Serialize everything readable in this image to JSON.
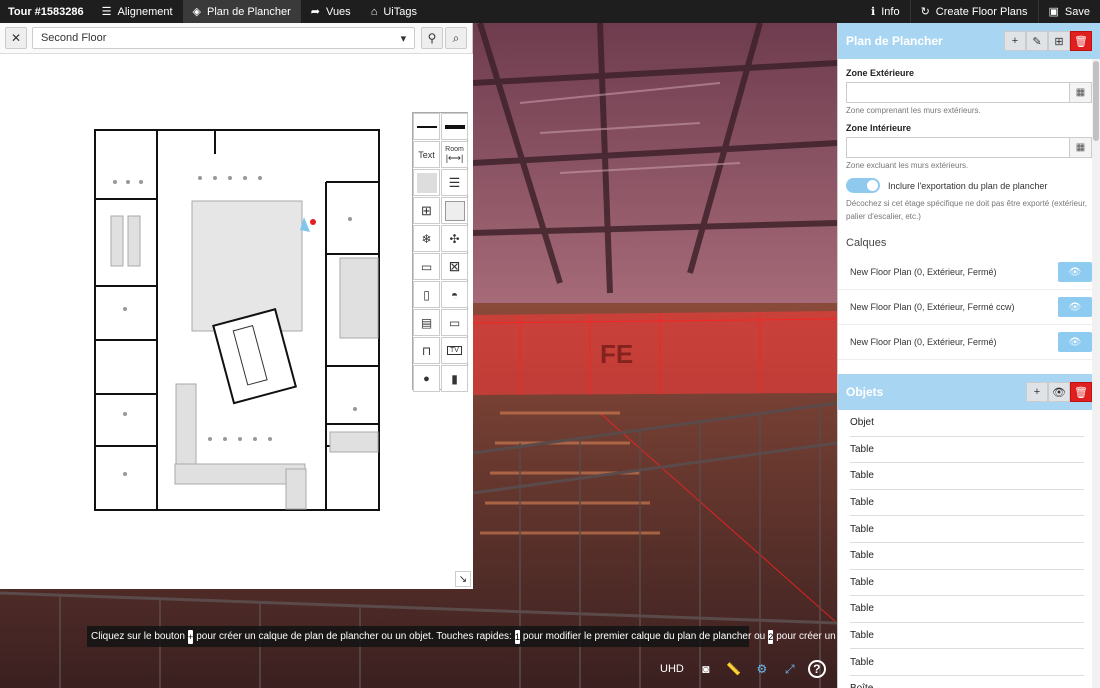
{
  "topbar": {
    "tour_id": "Tour #1583286",
    "nav": [
      {
        "label": "Alignement",
        "icon": "list-icon"
      },
      {
        "label": "Plan de Plancher",
        "icon": "layers-icon"
      },
      {
        "label": "Vues",
        "icon": "share-icon"
      },
      {
        "label": "UiTags",
        "icon": "tag-icon"
      }
    ],
    "info_label": "Info",
    "create_label": "Create Floor Plans",
    "save_label": "Save"
  },
  "floorplan": {
    "selected_floor": "Second Floor",
    "palette_text_label": "Text",
    "palette_room_label": "Room",
    "palette_tv_label": "TV"
  },
  "hint": {
    "part1": "Cliquez sur le bouton",
    "part2": "pour créer un calque de plan de plancher ou un objet. Touches rapides:",
    "key1": "1",
    "part3": "pour modifier le premier calque du plan de plancher ou",
    "key2": "2",
    "part4": "pour créer un nouvel objet."
  },
  "bottom": {
    "uhd_label": "UHD"
  },
  "side": {
    "title": "Plan de Plancher",
    "exterior_label": "Zone Extérieure",
    "exterior_help": "Zone comprenant les murs extérieurs.",
    "interior_label": "Zone Intérieure",
    "interior_help": "Zone excluant les murs extérieurs.",
    "include_label": "Inclure l'exportation du plan de plancher",
    "include_help": "Décochez si cet étage spécifique ne doit pas être exporté (extérieur, palier d'escalier, etc.)",
    "layers_title": "Calques",
    "layers": [
      "New Floor Plan (0, Extérieur, Fermé)",
      "New Floor Plan (0, Extérieur, Fermé ccw)",
      "New Floor Plan (0, Extérieur, Fermé)"
    ],
    "objects_title": "Objets",
    "objects": [
      "Objet",
      "Table",
      "Table",
      "Table",
      "Table",
      "Table",
      "Table",
      "Table",
      "Table",
      "Table",
      "Boîte"
    ]
  }
}
